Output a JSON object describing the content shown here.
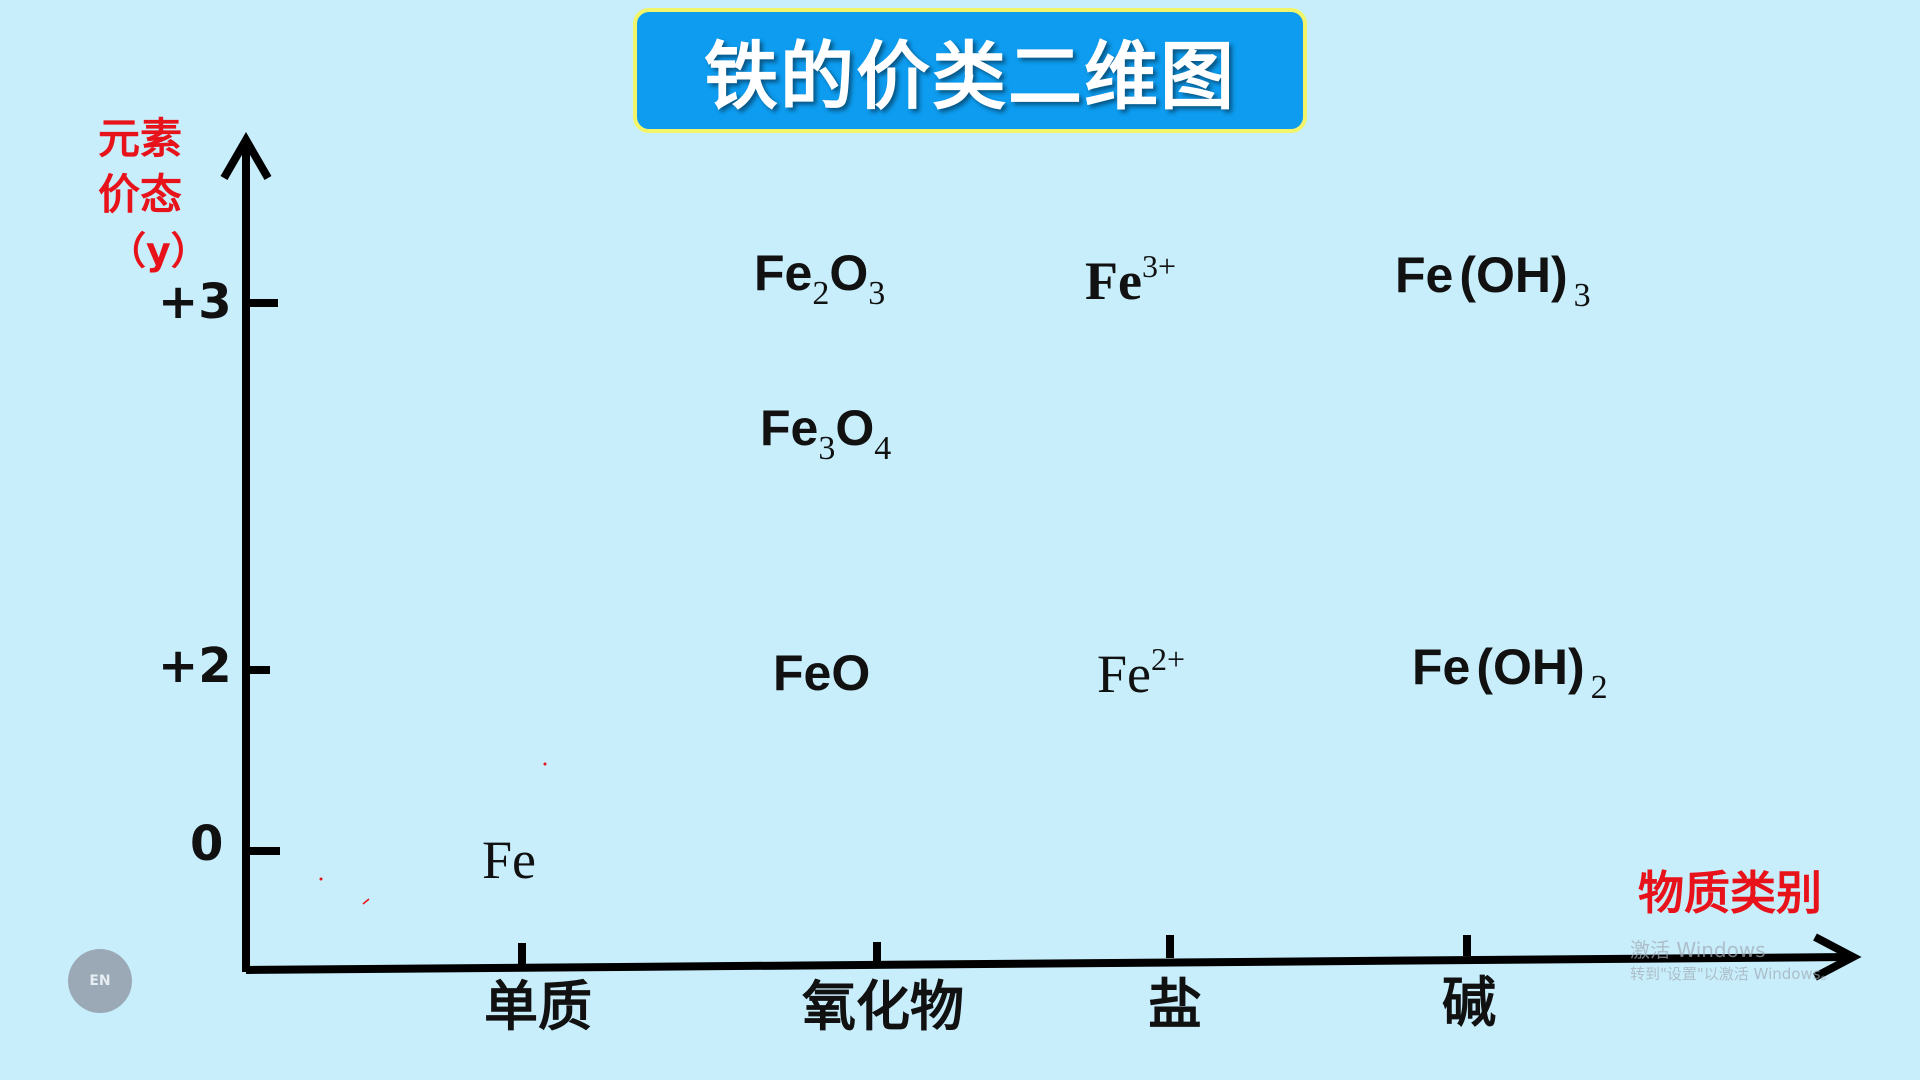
{
  "title": "铁的价类二维图",
  "y_axis": {
    "label_line1": "元素",
    "label_line2": "价态",
    "label_line3": "（y）",
    "ticks": [
      "+3",
      "+2",
      "0"
    ]
  },
  "x_axis": {
    "label": "物质类别",
    "categories": [
      "单质",
      "氧化物",
      "盐",
      "碱"
    ]
  },
  "formulas": {
    "fe": "Fe",
    "fe2o3": {
      "base": "Fe",
      "s1": "2",
      "mid": "O",
      "s2": "3"
    },
    "fe3o4": {
      "base": "Fe",
      "s1": "3",
      "mid": "O",
      "s2": "4"
    },
    "feo": "FeO",
    "fe3plus": {
      "base": "Fe",
      "sup": "3+"
    },
    "fe2plus": {
      "base": "Fe",
      "sup": "2+"
    },
    "feoh3": {
      "base": "Fe",
      "paren": "(OH)",
      "sub": "3"
    },
    "feoh2": {
      "base": "Fe",
      "paren": "(OH)",
      "sub": "2"
    }
  },
  "watermark": {
    "line1": "激活 Windows",
    "line2": "转到\"设置\"以激活 Windows。"
  },
  "badge": "EN",
  "colors": {
    "background": "#c8eefc",
    "title_box": "#0d9cf0",
    "title_border": "#f2f56a",
    "axis_label": "#e8121a"
  }
}
